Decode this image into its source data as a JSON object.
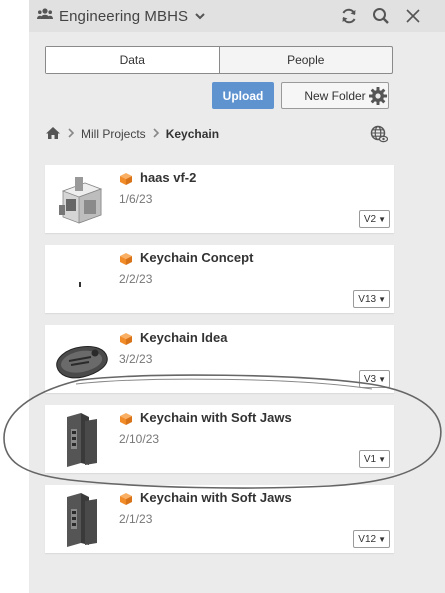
{
  "header": {
    "team_name": "Engineering MBHS",
    "icons": [
      "team-icon",
      "chevron-down-icon",
      "refresh-icon",
      "search-icon",
      "close-icon"
    ]
  },
  "tabs": [
    {
      "label": "Data",
      "active": true
    },
    {
      "label": "People",
      "active": false
    }
  ],
  "toolbar": {
    "upload_label": "Upload",
    "new_folder_label": "New Folder",
    "colors": {
      "upload_bg": "#5e93d0",
      "upload_text": "#ffffff"
    }
  },
  "breadcrumb": {
    "items": [
      "Mill Projects"
    ],
    "current": "Keychain"
  },
  "items": [
    {
      "name": "haas vf-2",
      "date": "1/6/23",
      "version": "V2",
      "thumbnail": "machine-thumbnail"
    },
    {
      "name": "Keychain Concept",
      "date": "2/2/23",
      "version": "V13",
      "thumbnail": "small-part-thumbnail"
    },
    {
      "name": "Keychain Idea",
      "date": "3/2/23",
      "version": "V3",
      "thumbnail": "keychain-thumbnail"
    },
    {
      "name": "Keychain with Soft Jaws",
      "date": "2/10/23",
      "version": "V1",
      "thumbnail": "soft-jaws-thumbnail"
    },
    {
      "name": "Keychain with Soft Jaws",
      "date": "2/1/23",
      "version": "V12",
      "thumbnail": "soft-jaws-thumbnail"
    }
  ],
  "accent_color": "#f28c28"
}
